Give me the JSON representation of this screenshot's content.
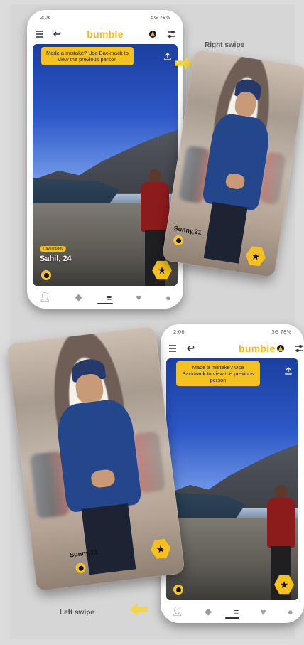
{
  "status": {
    "time": "2:06",
    "right": "5G 78%"
  },
  "brand": {
    "name": "bumble",
    "accent": "#f2b81d"
  },
  "toast": {
    "text": "Made a mistake? Use Backtrack to view the previous person"
  },
  "profile_main": {
    "chip": "Travel buddy",
    "name": "Sahil, 24"
  },
  "profile_card": {
    "name": "Sunny,21"
  },
  "captions": {
    "right": "Right swipe",
    "left": "Left swipe"
  },
  "nav": {
    "items": [
      "person-icon",
      "diamond-icon",
      "stack-icon",
      "heart-icon",
      "chat-icon"
    ]
  }
}
